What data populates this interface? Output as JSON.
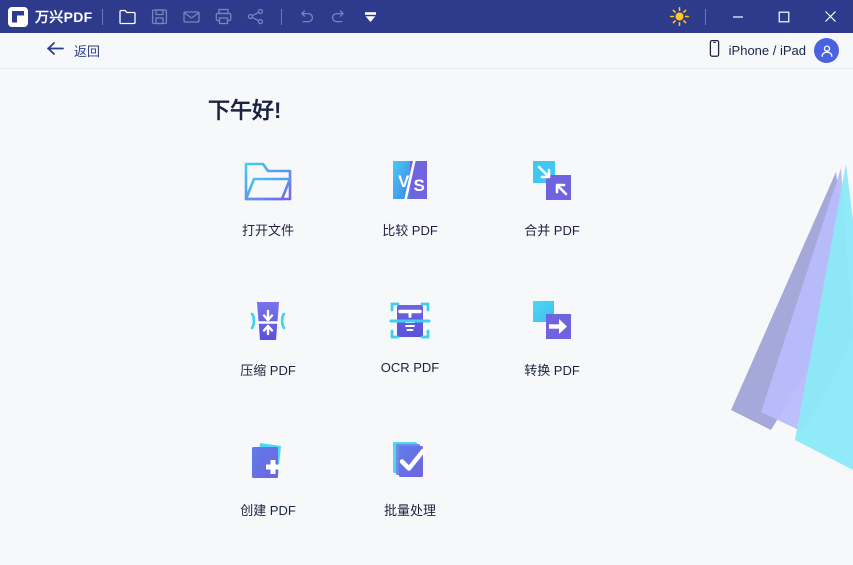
{
  "window": {
    "brand_name": "万兴PDF",
    "logo_icon": "wondershare-logo-icon",
    "toolbar": [
      {
        "name": "open-file-icon",
        "label": "打开",
        "active": true
      },
      {
        "name": "save-icon",
        "label": "保存",
        "active": false
      },
      {
        "name": "mail-icon",
        "label": "邮件",
        "active": false
      },
      {
        "name": "print-icon",
        "label": "打印",
        "active": false
      },
      {
        "name": "share-icon",
        "label": "分享",
        "active": false
      },
      {
        "name": "undo-icon",
        "label": "撤销",
        "active": false
      },
      {
        "name": "redo-icon",
        "label": "重做",
        "active": false
      },
      {
        "name": "more-dropdown-icon",
        "label": "更多",
        "active": true
      }
    ],
    "theme_icon": "sun-icon",
    "minimize_label": "最小化",
    "maximize_label": "最大化",
    "close_label": "关闭"
  },
  "subbar": {
    "back_icon": "arrow-left-icon",
    "back_label": "返回",
    "device_icon": "phone-icon",
    "device_label": "iPhone / iPad",
    "avatar_icon": "user-avatar-icon"
  },
  "main": {
    "greeting": "下午好!",
    "tiles": [
      {
        "icon": "open-folder-icon",
        "label": "打开文件"
      },
      {
        "icon": "compare-pdf-icon",
        "label": "比较 PDF"
      },
      {
        "icon": "merge-pdf-icon",
        "label": "合并 PDF"
      },
      {
        "icon": "compress-pdf-icon",
        "label": "压缩 PDF"
      },
      {
        "icon": "ocr-pdf-icon",
        "label": "OCR PDF"
      },
      {
        "icon": "convert-pdf-icon",
        "label": "转换 PDF"
      },
      {
        "icon": "create-pdf-icon",
        "label": "创建 PDF"
      },
      {
        "icon": "batch-process-icon",
        "label": "批量处理"
      }
    ]
  },
  "colors": {
    "titlebar_bg": "#2e3a8c",
    "page_bg": "#f7f8fa",
    "accent_blue": "#4b62e0",
    "accent_cyan": "#3fd0f0",
    "accent_purple": "#6f63e0",
    "text_dark": "#1c2340",
    "sun_yellow": "#ffc821",
    "decor_slate": "#9fa4d8",
    "decor_lavender": "#b9bcfb",
    "decor_cyan": "#8ae9f7"
  }
}
